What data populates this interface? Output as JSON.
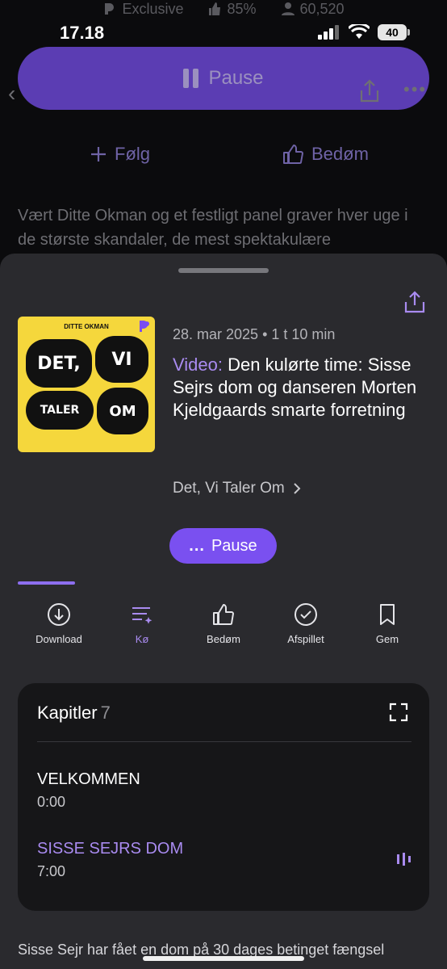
{
  "stats": {
    "exclusive": "Exclusive",
    "rating": "85%",
    "followers": "60,520"
  },
  "status_bar": {
    "time": "17.18",
    "battery": "40"
  },
  "mini_player": {
    "label": "Pause"
  },
  "follow": {
    "follow_label": "Følg",
    "rate_label": "Bedøm"
  },
  "show_description": "Vært Ditte Okman og et festligt panel graver hver uge i de største skandaler, de mest spektakulære",
  "episode": {
    "date": "28. mar 2025 • 1 t 10 min",
    "prefix": "Video:",
    "title": "Den kulørte time: Sisse Sejrs dom og danseren Morten Kjeldgaards smarte forretning",
    "show": "Det, Vi Taler Om",
    "progress": 0.14
  },
  "cover": {
    "author": "DITTE OKMAN",
    "w1": "DET,",
    "w2": "VI",
    "w3": "TALER",
    "w4": "OM"
  },
  "player": {
    "pause_label": "Pause",
    "dots": "..."
  },
  "actions": [
    {
      "label": "Download",
      "icon": "download-icon"
    },
    {
      "label": "Kø",
      "icon": "queue-icon"
    },
    {
      "label": "Bedøm",
      "icon": "thumbs-up-icon"
    },
    {
      "label": "Afspillet",
      "icon": "check-circle-icon"
    },
    {
      "label": "Gem",
      "icon": "bookmark-icon"
    }
  ],
  "chapters": {
    "heading": "Kapitler",
    "count": "7",
    "items": [
      {
        "title": "VELKOMMEN",
        "time": "0:00"
      },
      {
        "title": "SISSE SEJRS DOM",
        "time": "7:00"
      }
    ]
  },
  "episode_description": "Sisse Sejr har fået en dom på 30 dages betinget fængsel",
  "colors": {
    "accent": "#7a50f0",
    "active_text": "#a98bf0",
    "sheet": "#2a2a2e",
    "cover": "#f5d73c"
  }
}
